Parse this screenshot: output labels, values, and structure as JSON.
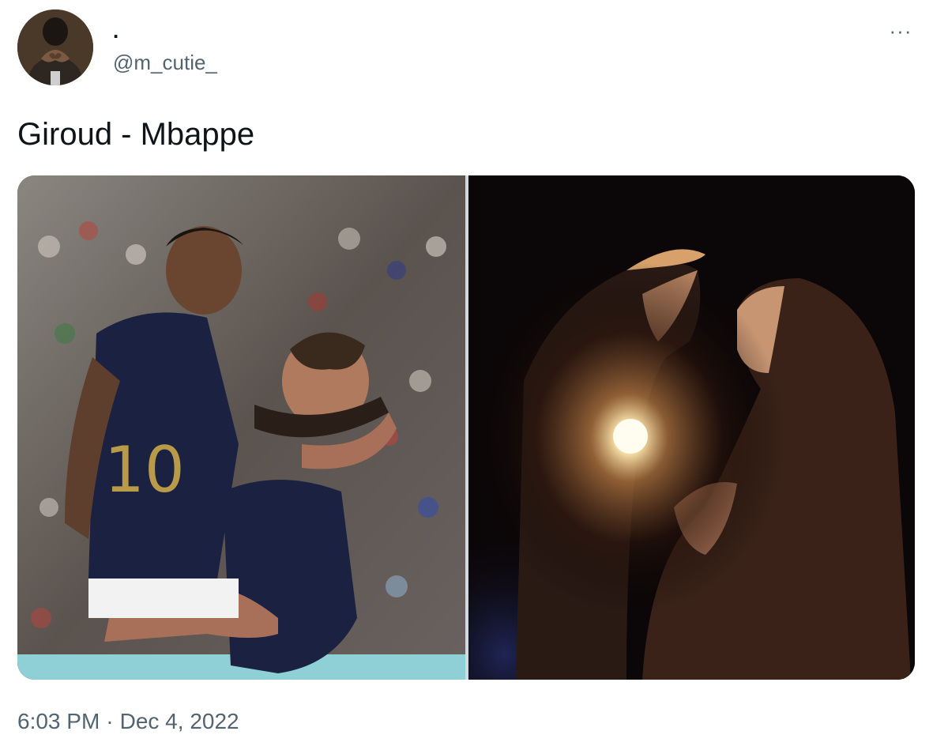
{
  "author": {
    "display_name": ".",
    "handle": "@m_cutie_",
    "avatar_alt": "avatar"
  },
  "more_icon": "more-horizontal-icon",
  "more_label": "···",
  "tweet": {
    "text": "Giroud - Mbappe",
    "time": "6:03 PM",
    "separator": "·",
    "date": "Dec 4, 2022"
  },
  "media": {
    "photos": [
      {
        "name": "photo-football-celebration"
      },
      {
        "name": "photo-couple-with-light"
      }
    ]
  },
  "colors": {
    "text_primary": "#0f1419",
    "text_secondary": "#536471",
    "jersey_blue": "#1b2140"
  }
}
